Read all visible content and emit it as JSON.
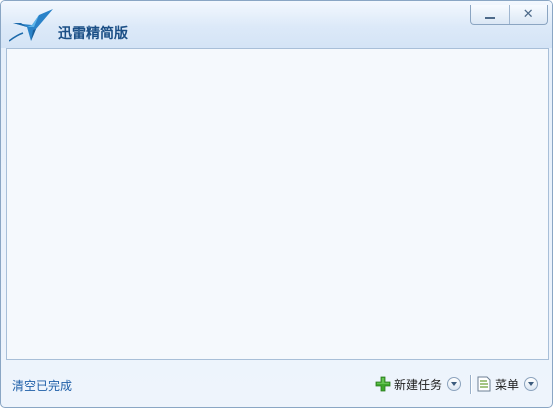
{
  "window": {
    "title": "迅雷精简版",
    "icons": {
      "logo": "xunlei-bird-logo",
      "minimize": "minimize-icon",
      "close": "close-icon"
    }
  },
  "bottombar": {
    "clear_completed_label": "清空已完成",
    "new_task_label": "新建任务",
    "menu_label": "菜单"
  },
  "colors": {
    "title_text": "#1b4f86",
    "link_text": "#1f5fa8",
    "plus_green": "#3fa82d",
    "window_border": "#8aa6c4"
  }
}
